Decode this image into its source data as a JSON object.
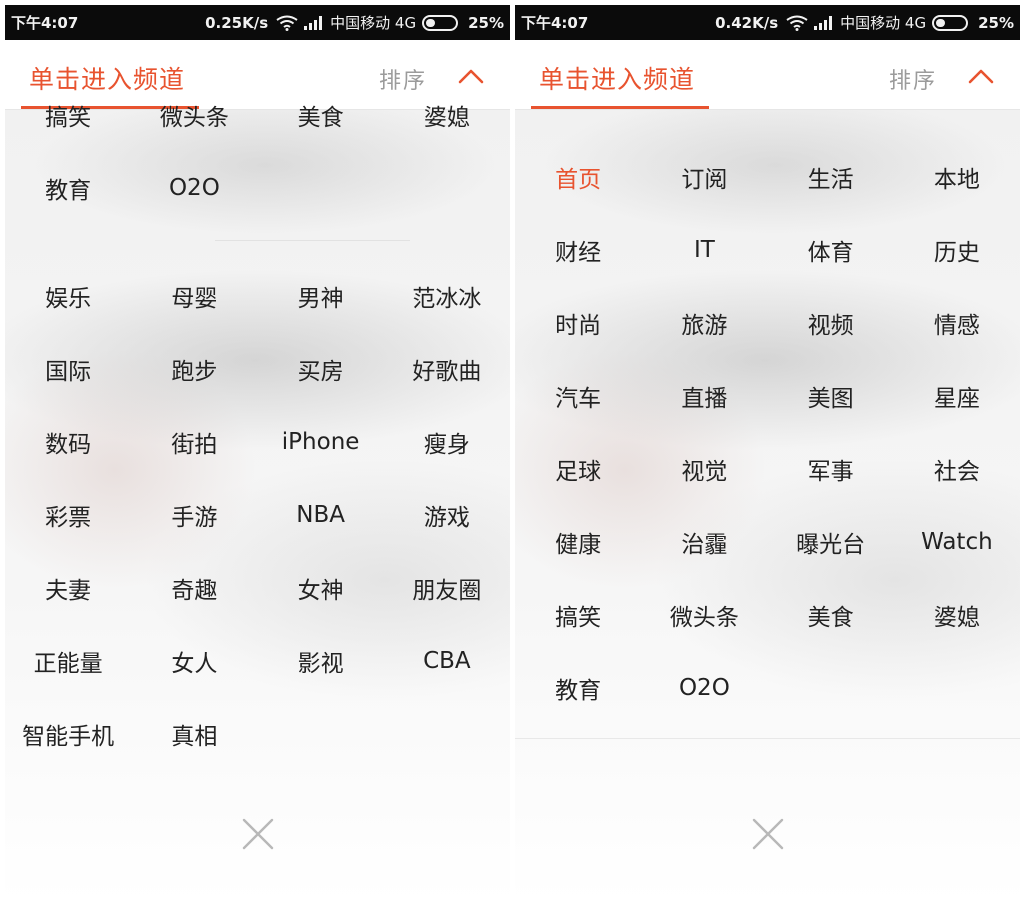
{
  "left": {
    "status": {
      "time": "下午4:07",
      "speed": "0.25K/s",
      "carrier": "中国移动 4G",
      "battery": "25%"
    },
    "header": {
      "title": "单击进入频道",
      "sort": "排序"
    },
    "top_items": [
      "搞笑",
      "微头条",
      "美食",
      "婆媳",
      "教育",
      "O2O"
    ],
    "bottom_items": [
      "娱乐",
      "母婴",
      "男神",
      "范冰冰",
      "国际",
      "跑步",
      "买房",
      "好歌曲",
      "数码",
      "街拍",
      "iPhone",
      "瘦身",
      "彩票",
      "手游",
      "NBA",
      "游戏",
      "夫妻",
      "奇趣",
      "女神",
      "朋友圈",
      "正能量",
      "女人",
      "影视",
      "CBA",
      "智能手机",
      "真相"
    ]
  },
  "right": {
    "status": {
      "time": "下午4:07",
      "speed": "0.42K/s",
      "carrier": "中国移动 4G",
      "battery": "25%"
    },
    "header": {
      "title": "单击进入频道",
      "sort": "排序"
    },
    "items": [
      "首页",
      "订阅",
      "生活",
      "本地",
      "财经",
      "IT",
      "体育",
      "历史",
      "时尚",
      "旅游",
      "视频",
      "情感",
      "汽车",
      "直播",
      "美图",
      "星座",
      "足球",
      "视觉",
      "军事",
      "社会",
      "健康",
      "治霾",
      "曝光台",
      "Watch",
      "搞笑",
      "微头条",
      "美食",
      "婆媳",
      "教育",
      "O2O"
    ]
  },
  "colors": {
    "accent": "#e8532f",
    "status_bar": "#0b0b0b",
    "text": "#222222",
    "muted": "#9b9b9b"
  },
  "icons": [
    "wifi-icon",
    "signal-icon",
    "battery-icon",
    "chevron-up-icon",
    "close-icon"
  ]
}
